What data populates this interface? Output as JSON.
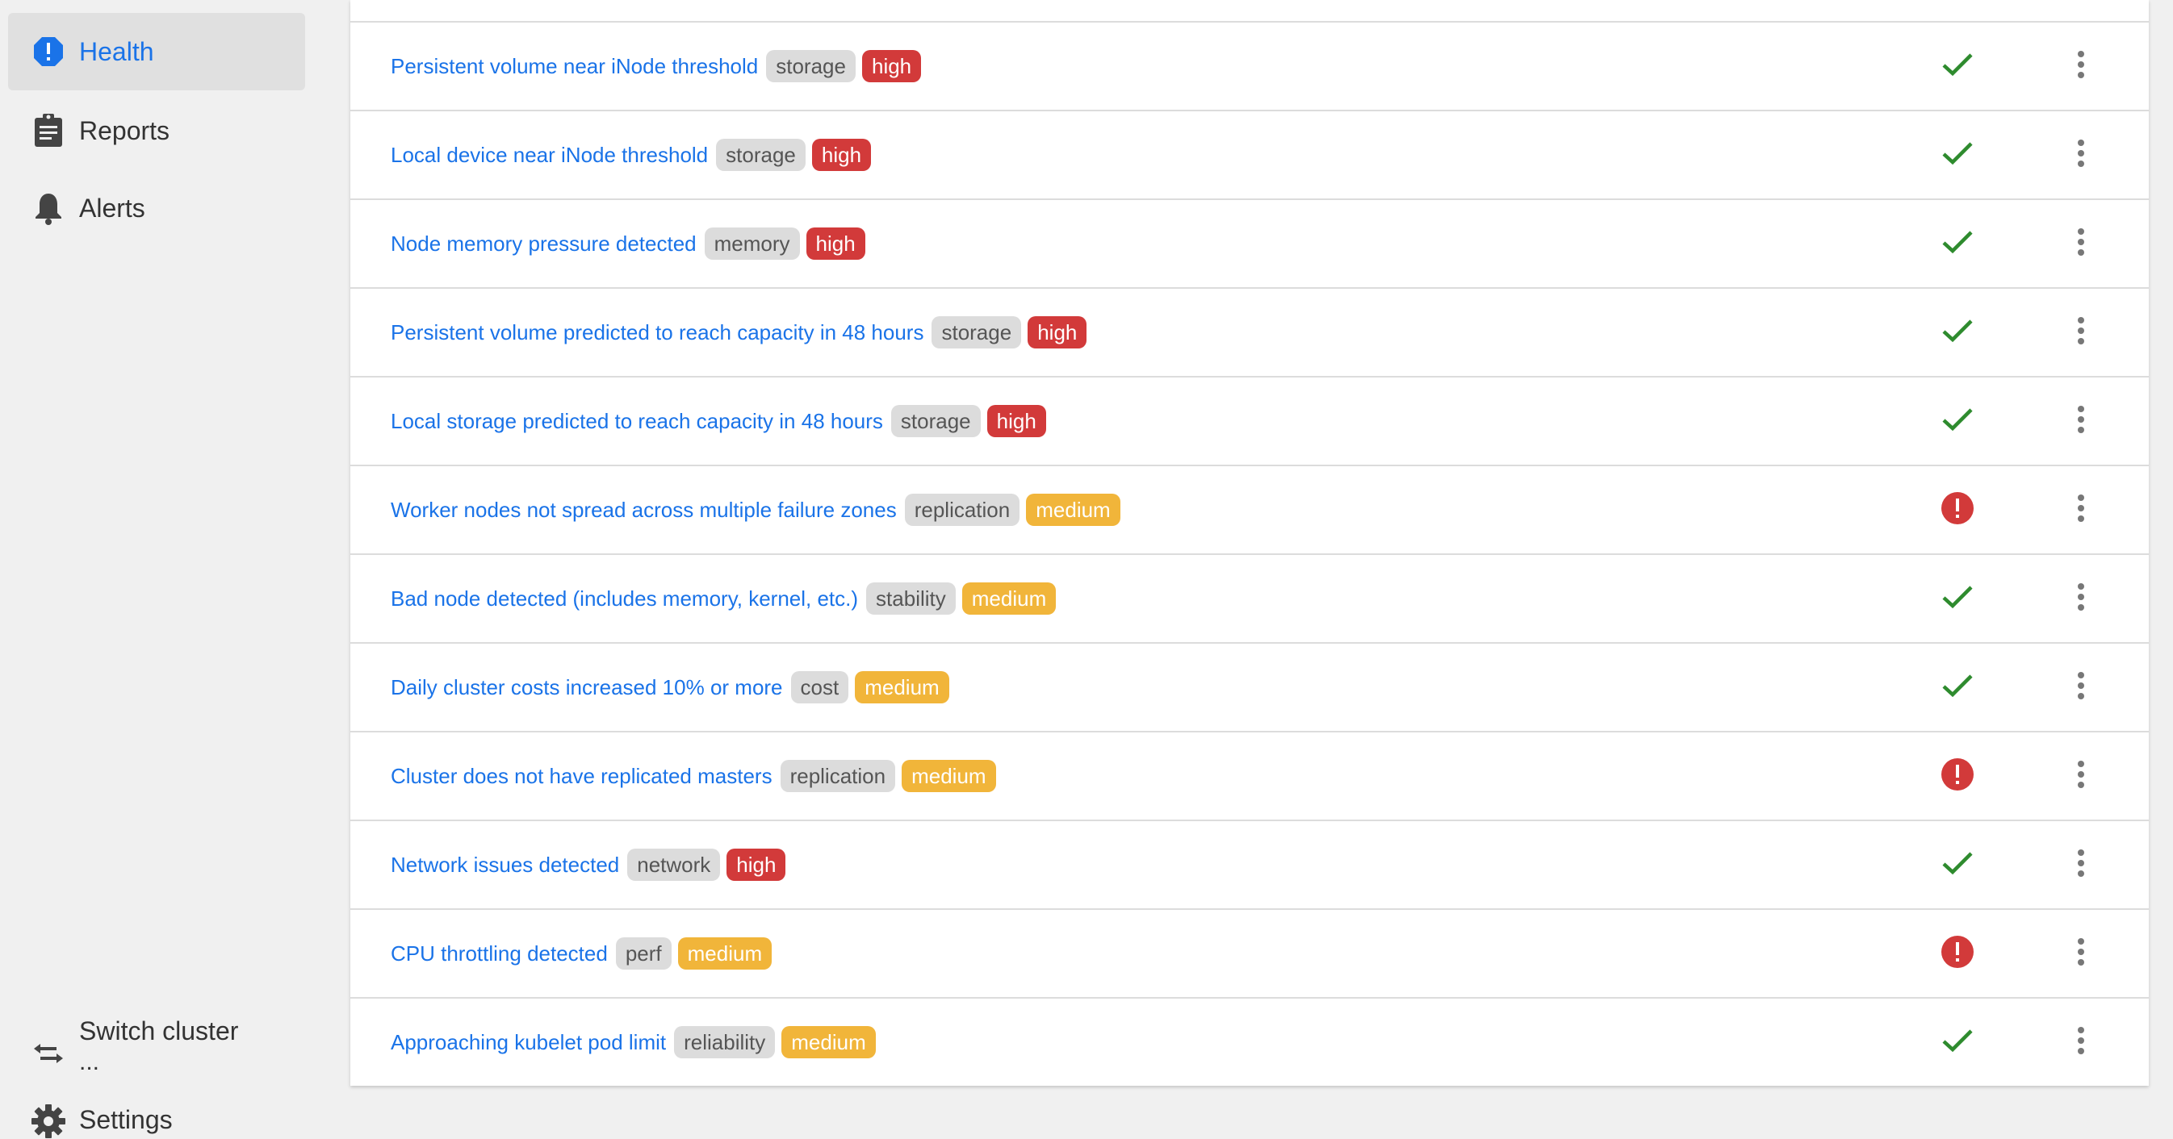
{
  "sidebar": {
    "items": [
      {
        "label": "Health",
        "icon": "health-alert-icon",
        "active": true
      },
      {
        "label": "Reports",
        "icon": "clipboard-icon"
      },
      {
        "label": "Alerts",
        "icon": "bell-icon"
      }
    ],
    "switch_cluster": {
      "label": "Switch cluster",
      "sub": "..."
    },
    "settings": {
      "label": "Settings"
    }
  },
  "colors": {
    "link": "#1a73e8",
    "high": "#d23a3a",
    "medium": "#f1b53a",
    "ok": "#2e8b2e",
    "error": "#d23a3a"
  },
  "checks": [
    {
      "title": "Persistent volume near iNode threshold",
      "category": "storage",
      "severity": "high",
      "status": "ok"
    },
    {
      "title": "Local device near iNode threshold",
      "category": "storage",
      "severity": "high",
      "status": "ok"
    },
    {
      "title": "Node memory pressure detected",
      "category": "memory",
      "severity": "high",
      "status": "ok"
    },
    {
      "title": "Persistent volume predicted to reach capacity in 48 hours",
      "category": "storage",
      "severity": "high",
      "status": "ok"
    },
    {
      "title": "Local storage predicted to reach capacity in 48 hours",
      "category": "storage",
      "severity": "high",
      "status": "ok"
    },
    {
      "title": "Worker nodes not spread across multiple failure zones",
      "category": "replication",
      "severity": "medium",
      "status": "error"
    },
    {
      "title": "Bad node detected (includes memory, kernel, etc.)",
      "category": "stability",
      "severity": "medium",
      "status": "ok"
    },
    {
      "title": "Daily cluster costs increased 10% or more",
      "category": "cost",
      "severity": "medium",
      "status": "ok"
    },
    {
      "title": "Cluster does not have replicated masters",
      "category": "replication",
      "severity": "medium",
      "status": "error"
    },
    {
      "title": "Network issues detected",
      "category": "network",
      "severity": "high",
      "status": "ok"
    },
    {
      "title": "CPU throttling detected",
      "category": "perf",
      "severity": "medium",
      "status": "error"
    },
    {
      "title": "Approaching kubelet pod limit",
      "category": "reliability",
      "severity": "medium",
      "status": "ok"
    }
  ]
}
